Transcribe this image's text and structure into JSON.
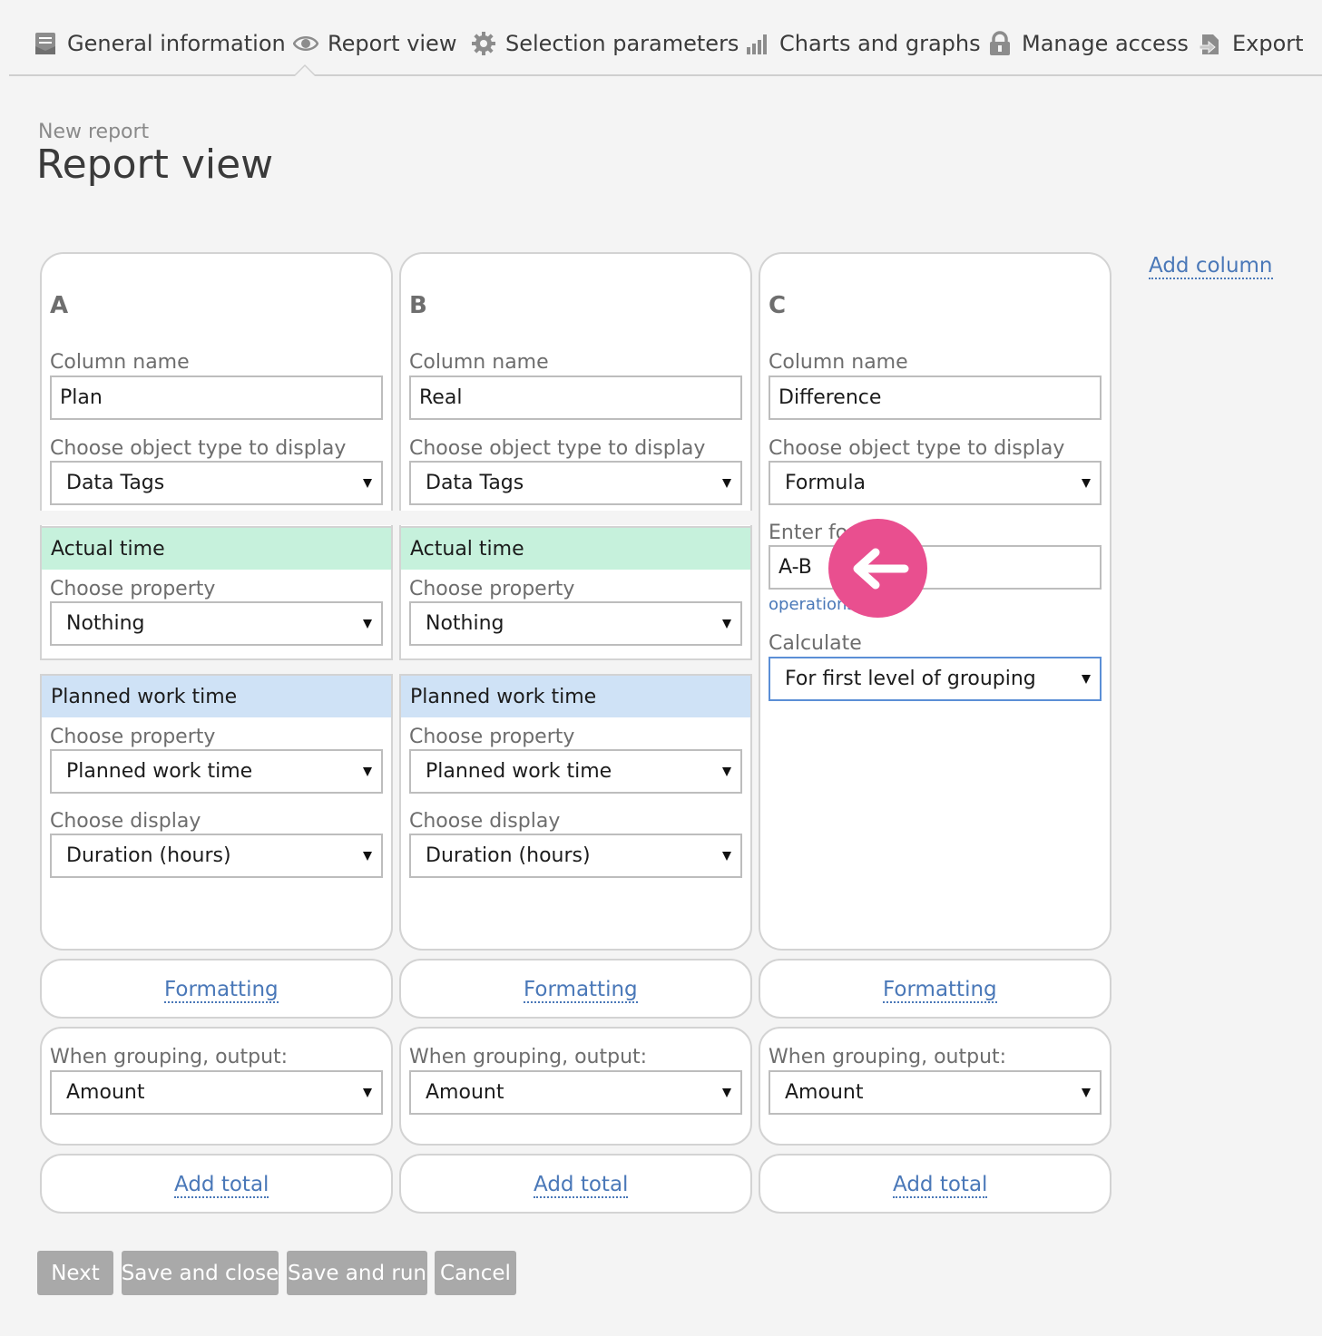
{
  "nav": {
    "tabs": [
      {
        "label": "General information",
        "icon": "document-icon"
      },
      {
        "label": "Report view",
        "icon": "eye-icon",
        "active": true
      },
      {
        "label": "Selection parameters",
        "icon": "gear-icon"
      },
      {
        "label": "Charts and graphs",
        "icon": "bar-chart-icon"
      },
      {
        "label": "Manage access",
        "icon": "lock-icon"
      },
      {
        "label": "Export",
        "icon": "export-icon"
      }
    ]
  },
  "header": {
    "breadcrumb": "New report",
    "title": "Report view"
  },
  "add_column_label": "Add column",
  "labels": {
    "column_name": "Column name",
    "choose_object_type": "Choose object type to display",
    "choose_property": "Choose property",
    "choose_display": "Choose display",
    "enter_formula": "Enter fo",
    "operations": "operations",
    "calculate": "Calculate",
    "formatting": "Formatting",
    "when_grouping": "When grouping, output:",
    "add_total": "Add total"
  },
  "columns": [
    {
      "letter": "A",
      "name": "Plan",
      "object_type": "Data Tags",
      "actual_time": {
        "header": "Actual time",
        "property": "Nothing"
      },
      "planned_work_time": {
        "header": "Planned work time",
        "property": "Planned work time",
        "display": "Duration (hours)"
      },
      "grouping_output": "Amount"
    },
    {
      "letter": "B",
      "name": "Real",
      "object_type": "Data Tags",
      "actual_time": {
        "header": "Actual time",
        "property": "Nothing"
      },
      "planned_work_time": {
        "header": "Planned work time",
        "property": "Planned work time",
        "display": "Duration (hours)"
      },
      "grouping_output": "Amount"
    },
    {
      "letter": "C",
      "name": "Difference",
      "object_type": "Formula",
      "formula": "A-B",
      "calculate": "For first level of grouping",
      "grouping_output": "Amount"
    }
  ],
  "buttons": {
    "next": "Next",
    "save_close": "Save and close",
    "save_run": "Save and run",
    "cancel": "Cancel"
  },
  "colors": {
    "accent_link": "#4a78b8",
    "actual_time_band": "#c6f1dc",
    "planned_time_band": "#cfe2f6",
    "callout": "#e94f8f",
    "button_bg": "#a9a9a9"
  }
}
